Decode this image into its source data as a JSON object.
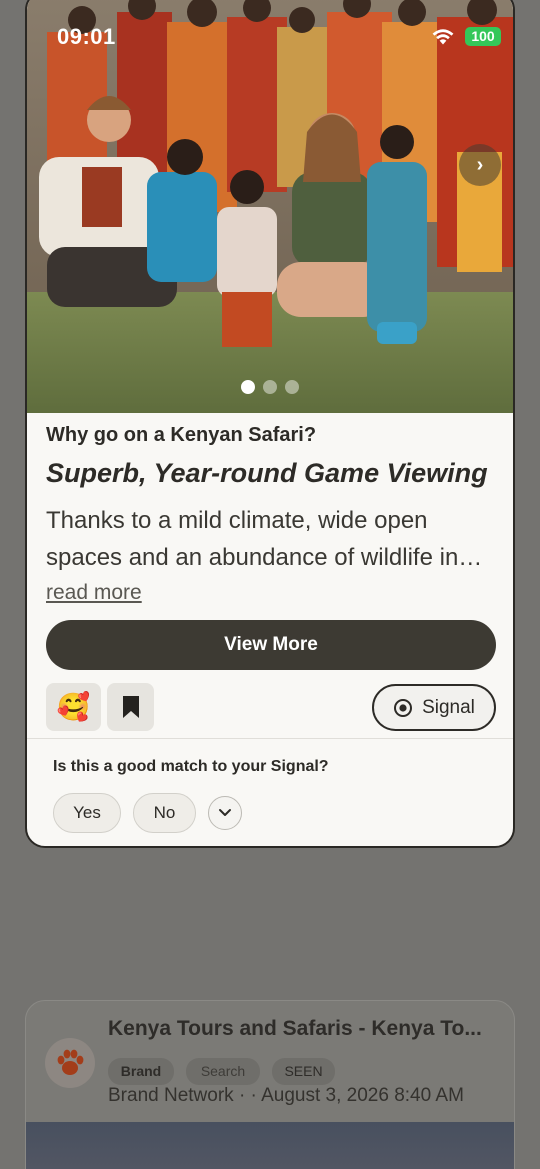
{
  "status_bar": {
    "time": "09:01",
    "battery": "100"
  },
  "post": {
    "carousel": {
      "total_slides": 3,
      "active_slide": 1
    },
    "eyebrow": "Why go on a Kenyan Safari?",
    "headline": "Superb, Year-round Game Viewing",
    "body_lines": [
      "Thanks to a mild climate, wide open",
      "spaces and an abundance of wildlife in…"
    ],
    "read_more": "read more",
    "view_more": "View More",
    "reaction_emoji": "🥰",
    "signal_label": "Signal"
  },
  "feedback": {
    "question": "Is this a good match to your Signal?",
    "yes": "Yes",
    "no": "No"
  },
  "next_card": {
    "title": "Kenya Tours and Safaris - Kenya To...",
    "tags": [
      "Brand",
      "Search",
      "SEEN"
    ],
    "meta": "Brand Network · · August 3, 2026 8:40 AM"
  },
  "colors": {
    "overlay": "#747370",
    "card_bg": "#f9f8f5",
    "primary_button": "#3d3a33",
    "battery": "#34c759",
    "brand_avatar": "#c0481f"
  }
}
